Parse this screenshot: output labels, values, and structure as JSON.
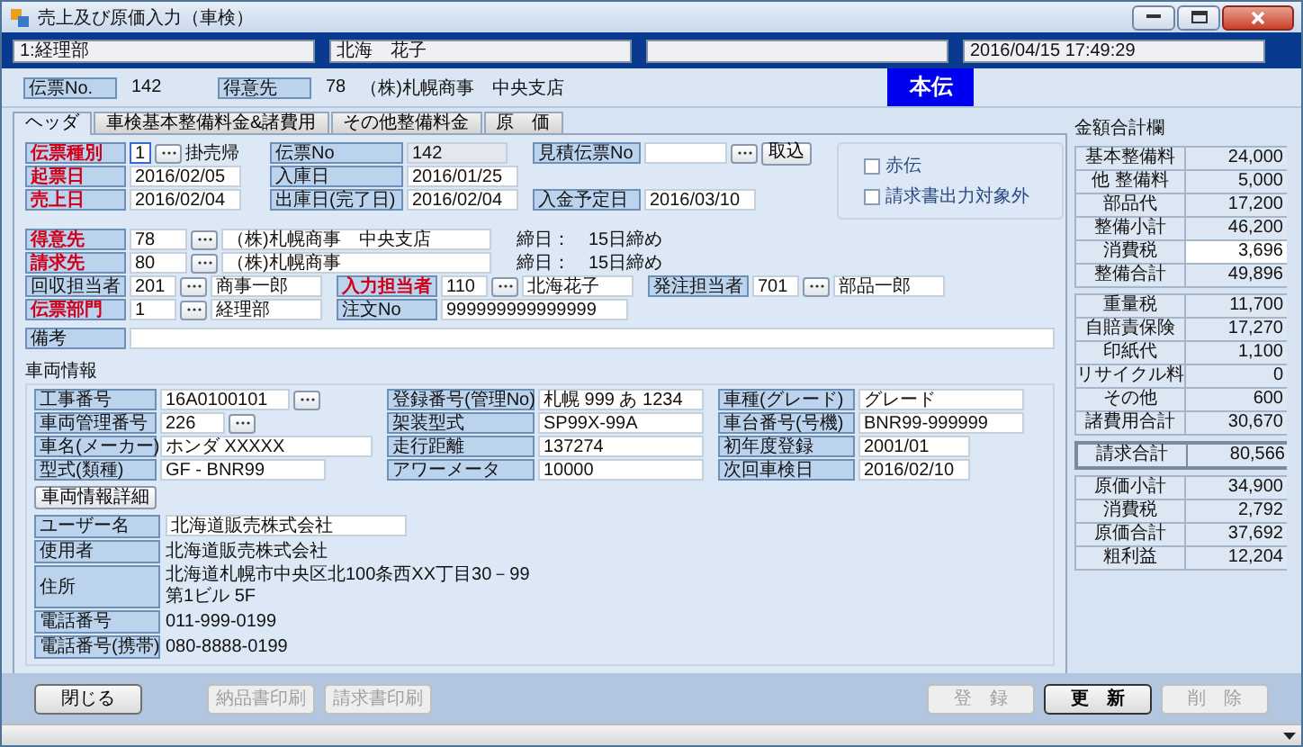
{
  "window": {
    "title": "売上及び原価入力（車検）"
  },
  "header_bar": {
    "department": "1:経理部",
    "user": "北海　花子",
    "timestamp": "2016/04/15 17:49:29"
  },
  "slip_bar": {
    "slip_no_label": "伝票No.",
    "slip_no": "142",
    "customer_label": "得意先",
    "customer_code": "78",
    "customer_name": "（株)札幌商事　中央支店",
    "badge": "本伝"
  },
  "tabs": [
    {
      "label": "ヘッダ",
      "selected": true
    },
    {
      "label": "車検基本整備料金&諸費用",
      "selected": false
    },
    {
      "label": "その他整備料金",
      "selected": false
    },
    {
      "label": "原　価",
      "selected": false
    }
  ],
  "header_form": {
    "slip_type": {
      "label": "伝票種別",
      "required": true,
      "code": "1",
      "name": "掛売帰"
    },
    "slip_no": {
      "label": "伝票No",
      "required": false,
      "value": "142"
    },
    "estimate_no": {
      "label": "見積伝票No",
      "required": false,
      "button": "取込"
    },
    "issue_date": {
      "label": "起票日",
      "required": true,
      "value": "2016/02/05"
    },
    "entry_date": {
      "label": "入庫日",
      "required": false,
      "value": "2016/01/25"
    },
    "sales_date": {
      "label": "売上日",
      "required": true,
      "value": "2016/02/04"
    },
    "exit_date": {
      "label": "出庫日(完了日)",
      "required": false,
      "value": "2016/02/04"
    },
    "payment_date": {
      "label": "入金予定日",
      "required": false,
      "value": "2016/03/10"
    },
    "options": [
      {
        "label": "赤伝",
        "checked": false
      },
      {
        "label": "請求書出力対象外",
        "checked": false
      }
    ],
    "customer": {
      "label": "得意先",
      "required": true,
      "code": "78",
      "name": "（株)札幌商事　中央支店",
      "note": "締日：　15日締め"
    },
    "billing": {
      "label": "請求先",
      "required": true,
      "code": "80",
      "name": "（株)札幌商事",
      "note": "締日：　15日締め"
    },
    "collector": {
      "label": "回収担当者",
      "required": false,
      "code": "201",
      "name": "商事一郎"
    },
    "input_staff": {
      "label": "入力担当者",
      "required": true,
      "code": "110",
      "name": "北海花子"
    },
    "order_staff": {
      "label": "発注担当者",
      "required": false,
      "code": "701",
      "name": "部品一郎"
    },
    "department": {
      "label": "伝票部門",
      "required": true,
      "code": "1",
      "name": "経理部"
    },
    "order_no": {
      "label": "注文No",
      "required": false,
      "value": "999999999999999"
    },
    "remarks": {
      "label": "備考",
      "required": false
    }
  },
  "vehicle": {
    "legend": "車両情報",
    "fields": [
      {
        "label": "工事番号",
        "value": "16A0100101",
        "lookup": true
      },
      {
        "label": "登録番号(管理No)",
        "value": "札幌 999 あ 1234",
        "lookup": false
      },
      {
        "label": "車種(グレード)",
        "value": "グレード",
        "lookup": false
      },
      {
        "label": "車両管理番号",
        "value": "226",
        "lookup": true
      },
      {
        "label": "架装型式",
        "value": "SP99X-99A",
        "lookup": false
      },
      {
        "label": "車台番号(号機)",
        "value": "BNR99-999999",
        "lookup": false
      },
      {
        "label": "車名(メーカー)",
        "value": "ホンダ XXXXX",
        "lookup": false
      },
      {
        "label": "走行距離",
        "value": "137274",
        "lookup": false
      },
      {
        "label": "初年度登録",
        "value": "2001/01",
        "lookup": false
      },
      {
        "label": "型式(類種)",
        "value": "GF - BNR99",
        "lookup": false
      },
      {
        "label": "アワーメータ",
        "value": "10000",
        "lookup": false
      },
      {
        "label": "次回車検日",
        "value": "2016/02/10",
        "lookup": false
      }
    ],
    "detail_button": "車両情報詳細",
    "user_info": [
      {
        "kind": "field",
        "label": "ユーザー名",
        "lines": [
          "北海道販売株式会社"
        ]
      },
      {
        "kind": "text",
        "label": "使用者",
        "lines": [
          "北海道販売株式会社"
        ]
      },
      {
        "kind": "text",
        "label": "住所",
        "lines": [
          "北海道札幌市中央区北100条西XX丁目30－99",
          "第1ビル 5F"
        ]
      },
      {
        "kind": "text",
        "label": "電話番号",
        "lines": [
          "011-999-0199"
        ]
      },
      {
        "kind": "text",
        "label": "電話番号(携帯)",
        "lines": [
          "080-8888-0199"
        ]
      }
    ]
  },
  "summary": {
    "title": "金額合計欄",
    "groups": [
      {
        "kind": "list",
        "rows": [
          {
            "label": "基本整備料",
            "value": "24,000",
            "editable": false
          },
          {
            "label": "他 整備料",
            "value": "5,000",
            "editable": false
          },
          {
            "label": "部品代",
            "value": "17,200",
            "editable": false
          },
          {
            "label": "整備小計",
            "value": "46,200",
            "editable": false
          },
          {
            "label": "消費税",
            "value": "3,696",
            "editable": true
          },
          {
            "label": "整備合計",
            "value": "49,896",
            "editable": false
          }
        ]
      },
      {
        "kind": "list",
        "rows": [
          {
            "label": "重量税",
            "value": "11,700",
            "editable": false
          },
          {
            "label": "自賠責保険",
            "value": "17,270",
            "editable": false
          },
          {
            "label": "印紙代",
            "value": "1,100",
            "editable": false
          },
          {
            "label": "リサイクル料",
            "value": "0",
            "editable": false
          },
          {
            "label": "その他",
            "value": "600",
            "editable": false
          },
          {
            "label": "諸費用合計",
            "value": "30,670",
            "editable": false
          }
        ]
      },
      {
        "kind": "total",
        "rows": [
          {
            "label": "請求合計",
            "value": "80,566",
            "editable": false
          }
        ]
      },
      {
        "kind": "list",
        "rows": [
          {
            "label": "原価小計",
            "value": "34,900",
            "editable": false
          },
          {
            "label": "消費税",
            "value": "2,792",
            "editable": false
          },
          {
            "label": "原価合計",
            "value": "37,692",
            "editable": false
          },
          {
            "label": "粗利益",
            "value": "12,204",
            "editable": false
          }
        ]
      }
    ]
  },
  "footer": {
    "left": [
      {
        "label": "閉じる",
        "disabled": false,
        "default": false
      }
    ],
    "print": [
      {
        "label": "納品書印刷",
        "disabled": true,
        "default": false
      },
      {
        "label": "請求書印刷",
        "disabled": true,
        "default": false
      }
    ],
    "right": [
      {
        "label": "登　録",
        "disabled": true,
        "default": false
      },
      {
        "label": "更　新",
        "disabled": false,
        "default": true
      },
      {
        "label": "削　除",
        "disabled": true,
        "default": false
      }
    ]
  }
}
